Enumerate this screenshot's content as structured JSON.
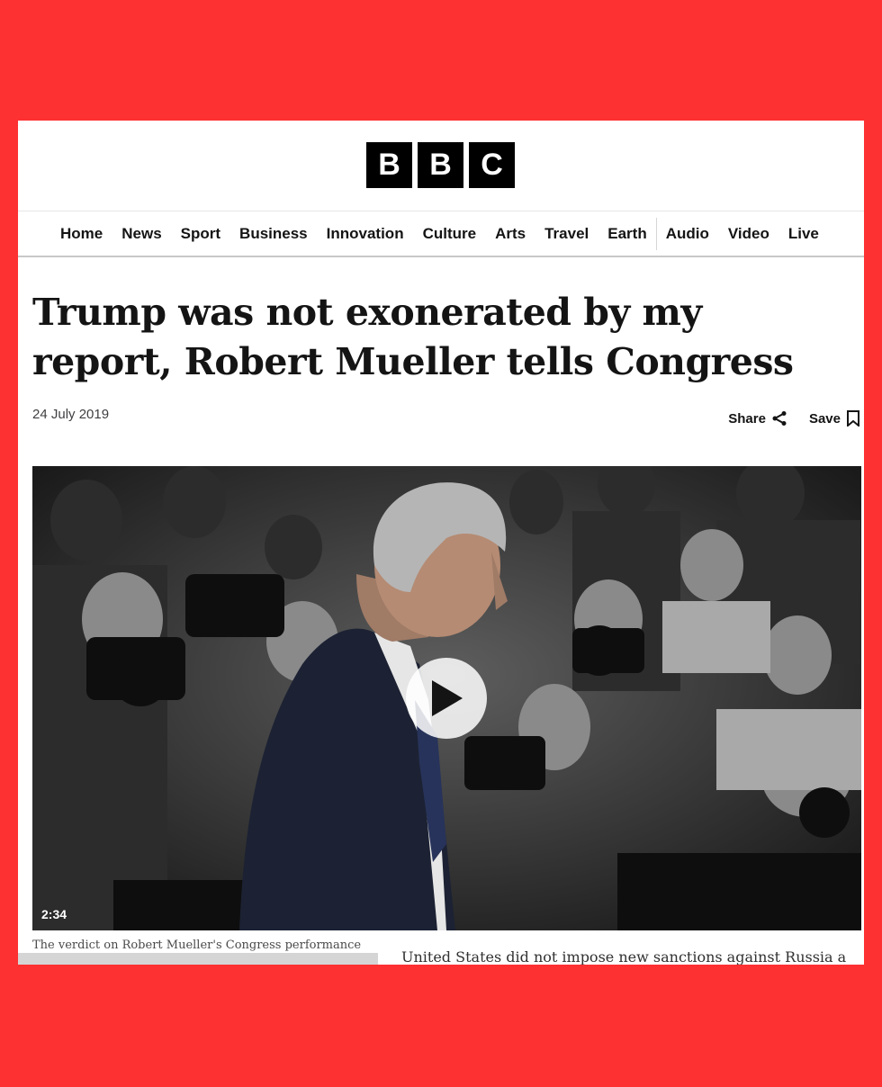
{
  "brand": {
    "letters": [
      "B",
      "B",
      "C"
    ]
  },
  "nav": {
    "items": [
      "Home",
      "News",
      "Sport",
      "Business",
      "Innovation",
      "Culture",
      "Arts",
      "Travel",
      "Earth",
      "Audio",
      "Video",
      "Live"
    ]
  },
  "article": {
    "headline": "Trump was not exonerated by my report, Robert Mueller tells Congress",
    "date": "24 July 2019",
    "share_label": "Share",
    "save_label": "Save"
  },
  "video": {
    "duration": "2:34",
    "caption": "The verdict on Robert Mueller's Congress performance"
  },
  "ticker": {
    "text": "United States did not impose new sanctions against Russia a"
  },
  "colors": {
    "frame": "#fd3032",
    "text": "#141414"
  }
}
